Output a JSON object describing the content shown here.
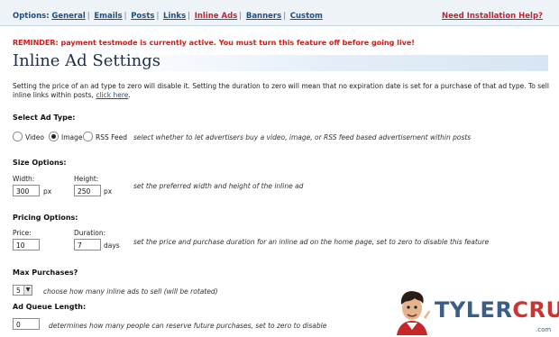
{
  "nav": {
    "label": "Options:",
    "items": [
      "General",
      "Emails",
      "Posts",
      "Links",
      "Inline Ads",
      "Banners",
      "Custom"
    ],
    "active": "Inline Ads",
    "help": "Need Installation Help?"
  },
  "reminder": "REMINDER: payment testmode is currently active. You must turn this feature off before going live!",
  "title": "Inline Ad Settings",
  "intro": {
    "text": "Setting the price of an ad type to zero will disable it. Setting the duration to zero will mean that no expiration date is set for a purchase of that ad type. To sell inline links within posts,",
    "link": "click here",
    "end": "."
  },
  "ad_type": {
    "heading": "Select Ad Type:",
    "options": [
      "Video",
      "Image",
      "RSS Feed"
    ],
    "selected": "Image",
    "description": "select whether to let advertisers buy a video, image, or RSS feed based advertisement within posts"
  },
  "size": {
    "heading": "Size Options:",
    "width_label": "Width:",
    "width_value": "300",
    "width_unit": "px",
    "height_label": "Height:",
    "height_value": "250",
    "height_unit": "px",
    "description": "set the preferred width and height of the inline ad"
  },
  "pricing": {
    "heading": "Pricing Options:",
    "price_label": "Price:",
    "price_value": "10",
    "duration_label": "Duration:",
    "duration_value": "7",
    "duration_unit": "days",
    "description": "set the price and purchase duration for an inline ad on the home page, set to zero to disable this feature"
  },
  "max_purchases": {
    "heading": "Max Purchases?",
    "value": "5",
    "description": "choose how many inline ads to sell (will be rotated)"
  },
  "queue": {
    "heading": "Ad Queue Length:",
    "value": "0",
    "description": "determines how many people can reserve future purchases, set to zero to disable"
  },
  "watermark": {
    "brand_part1": "TYLER",
    "brand_part2": "CRUZ",
    "suffix": ".com"
  },
  "colors": {
    "link": "#1d4f86",
    "active": "#c8202e",
    "reminder": "#d01b1b"
  }
}
